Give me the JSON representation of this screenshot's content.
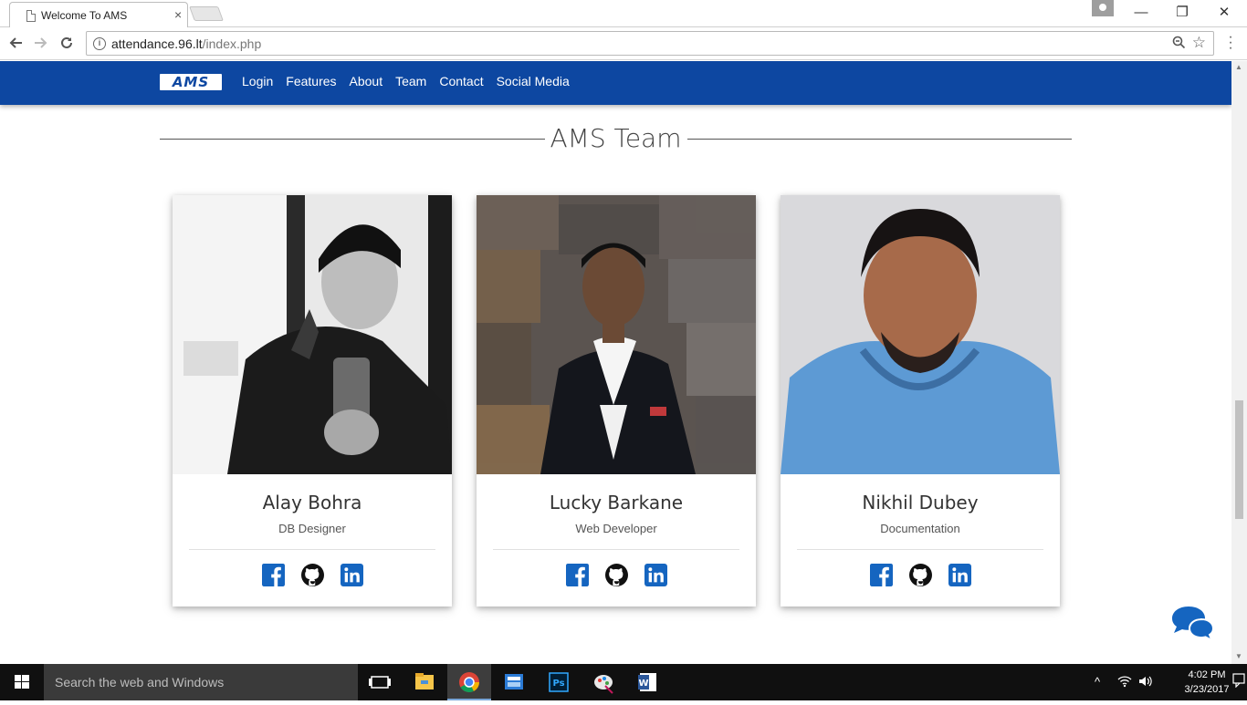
{
  "browser": {
    "tab_title": "Welcome To AMS",
    "tab_close": "×",
    "url_host": "attendance.96.lt",
    "url_path": "/index.php",
    "window_controls": {
      "minimize": "—",
      "restore": "❐",
      "close": "✕"
    }
  },
  "navbar": {
    "logo_text": "AMS",
    "links": [
      "Login",
      "Features",
      "About",
      "Team",
      "Contact",
      "Social Media"
    ],
    "brand_color": "#0d47a1"
  },
  "section": {
    "title": "AMS Team"
  },
  "team": [
    {
      "name": "Alay Bohra",
      "role": "DB Designer"
    },
    {
      "name": "Lucky Barkane",
      "role": "Web Developer"
    },
    {
      "name": "Nikhil Dubey",
      "role": "Documentation"
    }
  ],
  "social_icons": [
    "facebook-icon",
    "github-icon",
    "linkedin-icon"
  ],
  "taskbar": {
    "search_placeholder": "Search the web and Windows",
    "time": "4:02 PM",
    "date": "3/23/2017"
  }
}
